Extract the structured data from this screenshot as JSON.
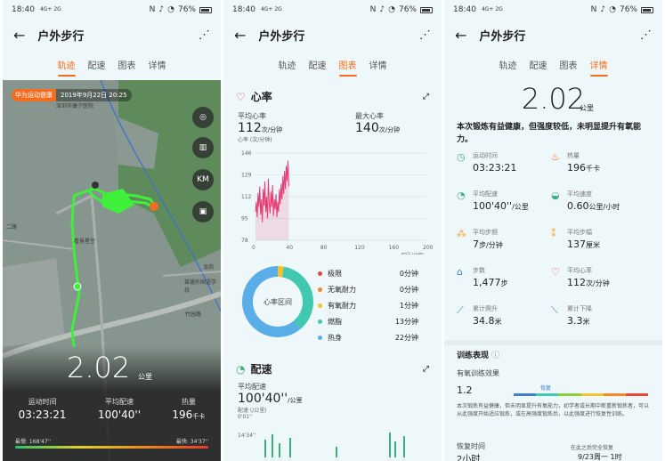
{
  "status": {
    "time": "18:40",
    "signal": "4G+ 2G",
    "battery": "76%",
    "icons": [
      "nfc-icon",
      "silent-icon",
      "wifi-icon",
      "battery-icon"
    ]
  },
  "header": {
    "title": "户外步行",
    "back_icon": "arrow-left-icon",
    "share_icon": "share-icon"
  },
  "tabs": [
    "轨迹",
    "配速",
    "图表",
    "详情"
  ],
  "colors": {
    "accent": "#f46c1f",
    "track": "#3ef03a",
    "heart": "#e63a72"
  },
  "track": {
    "source_badge": "华为运动健康",
    "date": "2019年9月22日 20:25",
    "map_buttons": [
      "location-icon",
      "map-icon",
      "KM",
      "layers-icon"
    ],
    "map_labels": [
      "深圳市康宁医院",
      "看景星空",
      "二路",
      "莱德外国语学校",
      "竹园路",
      "龙岗"
    ],
    "distance": "2.02",
    "distance_unit": "公里",
    "stats": [
      {
        "label": "运动时间",
        "value": "03:23:21",
        "unit": ""
      },
      {
        "label": "平均配速",
        "value": "100'40''",
        "unit": ""
      },
      {
        "label": "热量",
        "value": "196",
        "unit": "千卡"
      }
    ],
    "fastest_label": "最慢: 168'47''",
    "slowest_label": "最快: 34'37''"
  },
  "chart": {
    "heart": {
      "title": "心率",
      "avg_label": "平均心率",
      "avg_value": "112",
      "avg_unit": "次/分钟",
      "max_label": "最大心率",
      "max_value": "140",
      "max_unit": "次/分钟",
      "y_unit": "心率 (次/分钟)",
      "x_unit": "时间 (分钟)"
    },
    "zones_center": "心率区间",
    "zones": [
      {
        "name": "极限",
        "value": "0分钟",
        "color": "#e8483a"
      },
      {
        "name": "无氧耐力",
        "value": "0分钟",
        "color": "#f08a2a"
      },
      {
        "name": "有氧耐力",
        "value": "1分钟",
        "color": "#f2c230"
      },
      {
        "name": "燃脂",
        "value": "13分钟",
        "color": "#40c9b0"
      },
      {
        "name": "热身",
        "value": "22分钟",
        "color": "#5aaee8"
      }
    ],
    "pace": {
      "title": "配速",
      "avg_label": "平均配速",
      "avg_value": "100'40''",
      "avg_unit": "/公里",
      "y_unit": "配速 (/公里)",
      "y_tick_top": "0'01''",
      "y_tick_mid": "14'34''"
    }
  },
  "chart_data": [
    {
      "type": "line",
      "title": "",
      "ylabel": "心率 (次/分钟)",
      "xlabel": "时间 (分钟)",
      "ylim": [
        78,
        146
      ],
      "yticks": [
        146,
        129,
        112,
        95,
        78
      ],
      "xticks": [
        0,
        40,
        80,
        120,
        160,
        200
      ],
      "x": [
        0,
        1,
        2,
        3,
        4,
        5,
        6,
        7,
        8,
        9,
        10,
        11,
        12,
        13,
        14,
        15,
        16,
        17,
        18,
        19,
        20,
        21,
        22,
        23,
        24,
        25,
        26,
        27,
        28,
        29,
        30,
        31,
        32,
        33,
        34,
        35,
        36,
        37,
        38,
        39
      ],
      "series": [
        {
          "values": [
            100,
            108,
            96,
            115,
            104,
            120,
            98,
            110,
            92,
            118,
            105,
            124,
            100,
            112,
            95,
            126,
            108,
            99,
            116,
            104,
            121,
            97,
            110,
            102,
            114,
            96,
            108,
            100,
            118,
            106,
            122,
            110,
            128,
            114,
            132,
            118,
            136,
            124,
            140,
            120
          ]
        }
      ]
    },
    {
      "type": "pie",
      "categories": [
        "极限",
        "无氧耐力",
        "有氧耐力",
        "燃脂",
        "热身"
      ],
      "values": [
        0,
        0,
        1,
        13,
        22
      ]
    }
  ],
  "detail": {
    "distance": "2.02",
    "distance_unit": "公里",
    "summary": "本次锻炼有益健康，但强度较低，未明显提升有氧能力。",
    "metrics": [
      {
        "icon": "timer-icon",
        "label": "运动时间",
        "value": "03:23:21",
        "unit": ""
      },
      {
        "icon": "flame-icon",
        "label": "热量",
        "value": "196",
        "unit": "千卡"
      },
      {
        "icon": "pace-gauge-icon",
        "label": "平均配速",
        "value": "100'40''",
        "unit": "/公里"
      },
      {
        "icon": "speed-gauge-icon",
        "label": "平均速度",
        "value": "0.60",
        "unit": "公里/小时"
      },
      {
        "icon": "footprints-icon",
        "label": "平均步频",
        "value": "7",
        "unit": "步/分钟"
      },
      {
        "icon": "stride-icon",
        "label": "平均步幅",
        "value": "137",
        "unit": "厘米"
      },
      {
        "icon": "shoe-icon",
        "label": "步数",
        "value": "1,477",
        "unit": "步"
      },
      {
        "icon": "heart-icon",
        "label": "平均心率",
        "value": "112",
        "unit": "次/分钟"
      },
      {
        "icon": "climb-icon",
        "label": "累计爬升",
        "value": "34.8",
        "unit": "米"
      },
      {
        "icon": "descend-icon",
        "label": "累计下降",
        "value": "3.3",
        "unit": "米"
      }
    ],
    "training_title": "训练表现",
    "aerobic_label": "有氧训练效果",
    "aerobic_value": "1.2",
    "recover_tag": "恢复",
    "aerobic_desc": "本次锻炼有益健康，但未明显提升有氧能力，初学者或长期中断重新锻炼者，可以从此强度开始适应锻炼，或在高强度锻炼后，以此强度进行恢复性训练。",
    "recovery_label": "恢复时间",
    "recovery_value": "2小时",
    "recovery_done_label": "在此之后完全恢复",
    "recovery_done_value": "9/23周一 1时"
  }
}
